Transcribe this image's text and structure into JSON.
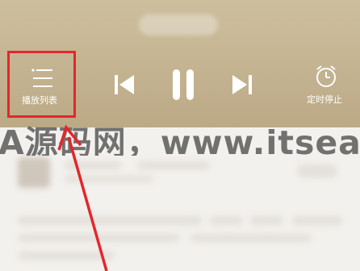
{
  "player": {
    "playlist_label": "播放列表",
    "timer_label": "定时停止"
  },
  "watermark": {
    "text": "A源码网，www.itsear.c"
  },
  "colors": {
    "header_bg": "#c7b894",
    "highlight": "#e3272b",
    "list_bg": "#f3f1ee"
  },
  "icons": {
    "playlist": "playlist-icon",
    "previous": "previous-track-icon",
    "pause": "pause-icon",
    "next": "next-track-icon",
    "timer": "alarm-clock-icon"
  }
}
